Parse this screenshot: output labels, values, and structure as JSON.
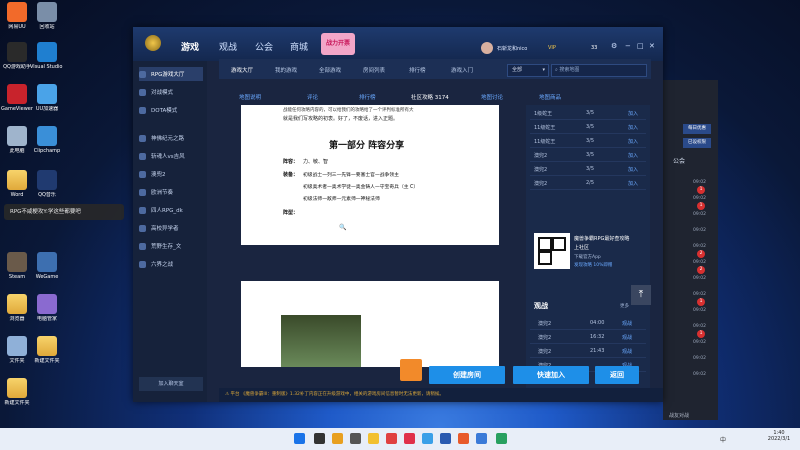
{
  "desktop": {
    "icons": [
      {
        "label": "网易UU"
      },
      {
        "label": "回收站"
      },
      {
        "label": "QQ游戏助手"
      },
      {
        "label": "Visual Studio Code"
      },
      {
        "label": "GameViewer"
      },
      {
        "label": "UU加速器"
      },
      {
        "label": "此电脑"
      },
      {
        "label": "Clipchamp"
      },
      {
        "label": "Word"
      },
      {
        "label": "QQ音乐"
      },
      {
        "label": "Steam"
      },
      {
        "label": "WeGame"
      },
      {
        "label": "浏览器"
      },
      {
        "label": "电脑管家"
      },
      {
        "label": "文件夹"
      },
      {
        "label": "Edge"
      },
      {
        "label": "Clipchamp"
      },
      {
        "label": "新建文件夹"
      },
      {
        "label": "新建文件夹"
      }
    ],
    "tooltip": "RPG不咸梗攻Y:学这些都要吧"
  },
  "window": {
    "nav": [
      "游戏",
      "观战",
      "公会",
      "商城"
    ],
    "promo_badge": "战力开票",
    "user_name": "石斩龙和nico",
    "vip_badge": "VIP",
    "coins": "33",
    "sidebar": [
      "RPG游戏大厅",
      "对战模式",
      "DOTA模式",
      "神佛纪元之路",
      "斩魂人vs吉风",
      "澳兜2",
      "欧洲节奏",
      "四人RPG_dk",
      "高校异学者",
      "荒野生存_文",
      "六界之战"
    ],
    "sidebar_bottom": "加入聊天室",
    "tabs": [
      "游戏大厅",
      "我的游戏",
      "全部游戏",
      "房间列表",
      "排行榜",
      "游戏入门"
    ],
    "filter_select": "全部",
    "search_placeholder": "搜索地图",
    "subtabs": [
      "地图说明",
      "评论",
      "排行榜",
      "社区攻略 3174",
      "地图讨论",
      "地图商品"
    ],
    "doc": {
      "intro_1": "战能任何攻略内容的，可以给我们的攻略给了一个评判标准所有大",
      "intro_2": "就是我们写攻略的初衷。好了，不废话，进入正题。",
      "heading": "第一部分 阵容分享",
      "label_camp": "阵容：",
      "camp_value": "力、敏、智",
      "label_build": "装备：",
      "build_1": "初级战士一列三一先锋一要塞士官一战争领主",
      "build_2": "初级奥术者一奥术学徒一奥金铸人一守宝奇兵（主 C）",
      "build_3": "初级法师一敌师一元素师一神秘法师",
      "label_type": "阵型：",
      "zoom_icon": "🔍"
    },
    "right_list": [
      {
        "name": "1级蛇王",
        "score": "3/5",
        "action": "加入"
      },
      {
        "name": "11级蛇王",
        "score": "3/5",
        "action": "加入"
      },
      {
        "name": "11级蛇王",
        "score": "3/5",
        "action": "加入"
      },
      {
        "name": "澳兜2",
        "score": "3/5",
        "action": "加入"
      },
      {
        "name": "澳兜2",
        "score": "3/5",
        "action": "加入"
      },
      {
        "name": "澳兜2",
        "score": "2/5",
        "action": "加入"
      }
    ],
    "qr": {
      "title": "魔兽争霸RPG最好查攻略",
      "line2": "上社区",
      "line3": "下载官方App",
      "line4": "发现攻略 10%即赠"
    },
    "watch_title": "观战",
    "watch_more": "更多",
    "watch_list": [
      {
        "name": "澳兜2",
        "time": "04:00",
        "action": "观战"
      },
      {
        "name": "澳兜2",
        "time": "16:32",
        "action": "观战"
      },
      {
        "name": "澳兜2",
        "time": "21:43",
        "action": "观战"
      },
      {
        "name": "澳兜2",
        "time": "",
        "action": "观战"
      }
    ],
    "buttons": {
      "create": "创建房间",
      "quick": "快速加入",
      "back": "返回"
    },
    "status_text": "平台 《魔兽争霸III：重制版》1.32补丁内容正在升级游戏中，相关的游戏房间信息暂时无法更新，请稍候。"
  },
  "back_window": {
    "tabs": [
      "每日优惠",
      "已设权限"
    ],
    "label": "公会",
    "times": [
      "09:02",
      "09:02",
      "09:02",
      "09:02",
      "09:02",
      "09:02",
      "09:02",
      "09:02",
      "09:02",
      "09:02",
      "09:02",
      "09:02",
      "09:02"
    ],
    "badges": [
      "1",
      "1",
      "2",
      "2",
      "1",
      "1"
    ],
    "footer": "战友对战"
  },
  "taskbar": {
    "time": "1:40",
    "date": "2022/3/1",
    "lang": "中"
  }
}
